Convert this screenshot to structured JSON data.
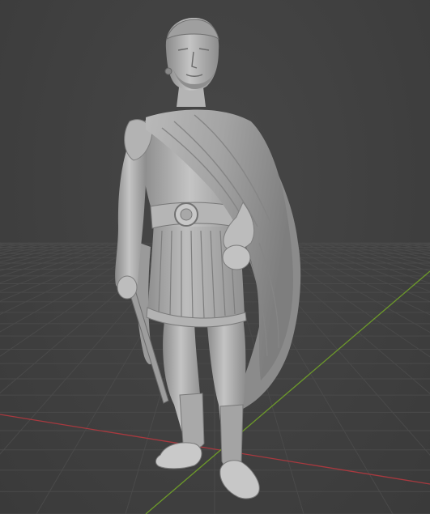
{
  "viewport": {
    "background_color": "#3d3d3d",
    "grid_color": "#4a4a4a",
    "x_axis_color": "#a8393f",
    "y_axis_color": "#6d9a2a",
    "model_color": "#a6a6a6",
    "model_highlight": "#cfcfcf",
    "model_shadow": "#6e6e6e",
    "grid_visible": true,
    "object": "statue-of-roman-soldier-with-cloak-and-sword"
  }
}
